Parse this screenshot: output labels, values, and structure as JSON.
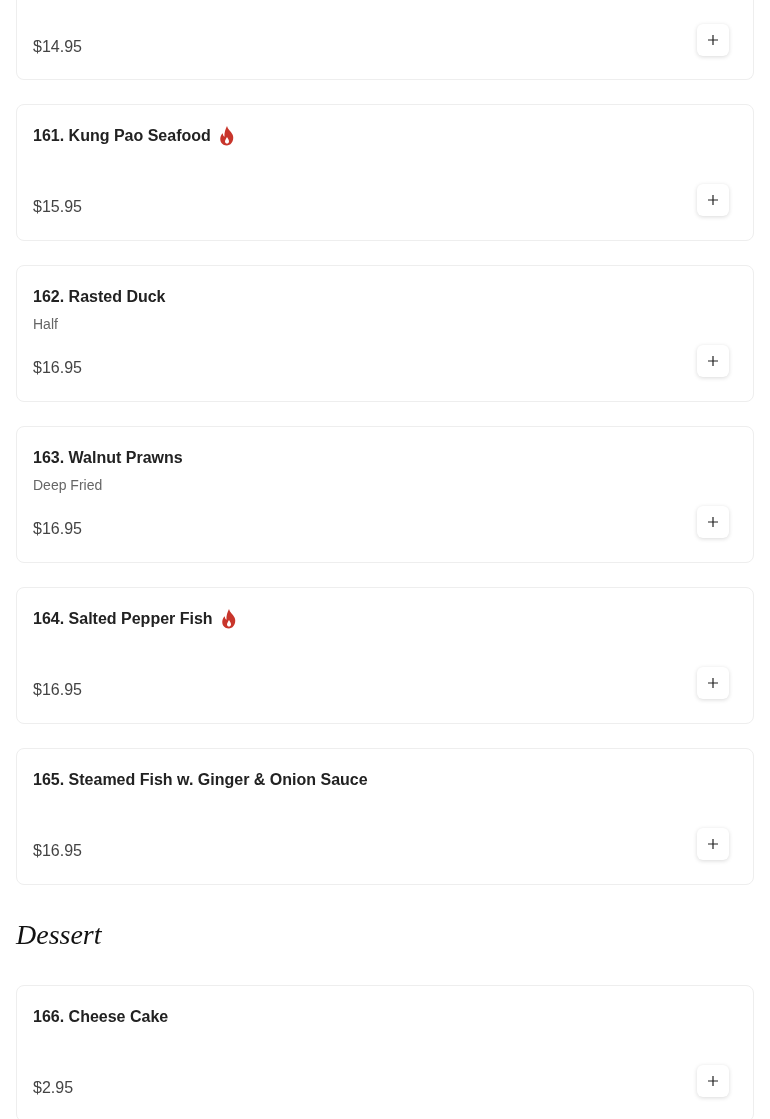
{
  "sections": [
    {
      "items": [
        {
          "kind": "partial",
          "price": "$14.95"
        },
        {
          "kind": "full",
          "name": "161. Kung Pao Seafood",
          "spicy": true,
          "price": "$15.95"
        },
        {
          "kind": "full",
          "name": "162. Rasted Duck",
          "description": "Half",
          "spicy": false,
          "price": "$16.95"
        },
        {
          "kind": "full",
          "name": "163. Walnut Prawns",
          "description": "Deep Fried",
          "spicy": false,
          "price": "$16.95"
        },
        {
          "kind": "full",
          "name": "164. Salted Pepper Fish",
          "spicy": true,
          "price": "$16.95"
        },
        {
          "kind": "full",
          "name": "165. Steamed Fish w. Ginger & Onion Sauce",
          "spicy": false,
          "price": "$16.95"
        }
      ]
    },
    {
      "title": "Dessert",
      "items": [
        {
          "kind": "full",
          "name": "166. Cheese Cake",
          "spicy": false,
          "price": "$2.95"
        }
      ]
    }
  ]
}
